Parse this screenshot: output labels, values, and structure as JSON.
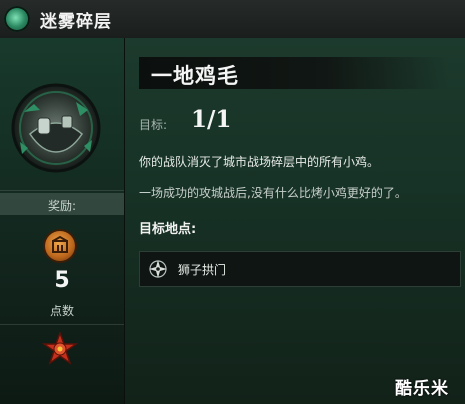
{
  "header": {
    "title": "迷雾碎层",
    "icon": "zone-emblem-icon"
  },
  "left_panel": {
    "emblem_icon": "shattered-stronghold-emblem",
    "reward_label": "奖励:",
    "reward_icon": "gate-coin-icon",
    "points": "5",
    "points_label": "点数",
    "badge_icon": "red-star-badge-icon"
  },
  "quest": {
    "title": "一地鸡毛",
    "goal_label": "目标:",
    "goal_value": "1/1",
    "description_1": "你的战队消灭了城市战场碎层中的所有小鸡。",
    "description_2": "一场成功的攻城战后,没有什么比烤小鸡更好的了。",
    "location_title": "目标地点:",
    "location_icon": "compass-icon",
    "location_name": "狮子拱门"
  },
  "watermark": "酷乐米",
  "colors": {
    "panel_green": "#173226",
    "header_dark": "#1a1e1c",
    "coin_orange": "#d98a2f",
    "badge_red": "#c0301c"
  }
}
